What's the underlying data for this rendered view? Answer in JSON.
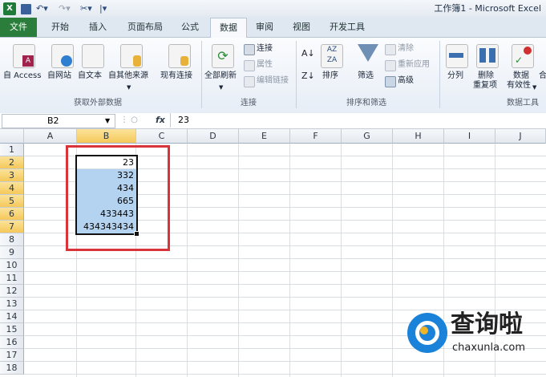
{
  "window": {
    "title": "工作簿1 - Microsoft Excel"
  },
  "tabs": [
    "文件",
    "开始",
    "插入",
    "页面布局",
    "公式",
    "数据",
    "审阅",
    "视图",
    "开发工具"
  ],
  "ribbon": {
    "get_external": {
      "items": [
        "自 Access",
        "自网站",
        "自文本",
        "自其他来源",
        "现有连接"
      ],
      "group_label": "获取外部数据"
    },
    "connections": {
      "refresh_all": "全部刷新",
      "connections": "连接",
      "properties": "属性",
      "edit_links": "编辑链接",
      "group_label": "连接"
    },
    "sort_filter": {
      "sort": "排序",
      "filter": "筛选",
      "clear": "清除",
      "reapply": "重新应用",
      "advanced": "高级",
      "group_label": "排序和筛选"
    },
    "data_tools": {
      "text_to_columns": "分列",
      "remove_dup_1": "删除",
      "remove_dup_2": "重复项",
      "validation_1": "数据",
      "validation_2": "有效性",
      "consolidate": "合",
      "group_label": "数据工具"
    }
  },
  "formula_bar": {
    "name_box": "B2",
    "fx": "fx",
    "value": "23"
  },
  "columns": [
    "A",
    "B",
    "C",
    "D",
    "E",
    "F",
    "G",
    "H",
    "I",
    "J"
  ],
  "rows": [
    "1",
    "2",
    "3",
    "4",
    "5",
    "6",
    "7",
    "8",
    "9",
    "10",
    "11",
    "12",
    "13",
    "14",
    "15",
    "16",
    "17",
    "18"
  ],
  "cells_B": [
    "23",
    "332",
    "434",
    "665",
    "433443",
    "434343434"
  ],
  "watermark": {
    "text": "查询啦",
    "url": "chaxunla.com"
  },
  "colors": {
    "selection": "#b4d3f0",
    "highlight_frame": "#d9343a",
    "file_tab": "#2a7d3a"
  }
}
